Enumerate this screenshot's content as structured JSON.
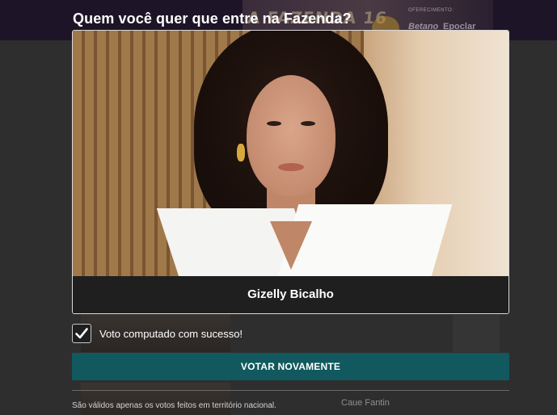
{
  "modal": {
    "title": "Quem você quer que entre na Fazenda?",
    "candidate": {
      "name": "Gizelly Bicalho",
      "photo_icon": "candidate-photo"
    },
    "success": {
      "icon": "check-icon",
      "text": "Voto computado com sucesso!"
    },
    "vote_again_label": "VOTAR NOVAMENTE",
    "validity_note": "São válidos apenas os votos feitos em território nacional."
  },
  "background": {
    "banner_title": "A FAZENDA 16",
    "sponsor_label": "OFERECIMENTO:",
    "sponsors": [
      "Betano",
      "Epoclar"
    ],
    "candidate_name_right": "Caue Fantin"
  },
  "colors": {
    "primary_button": "#11595e",
    "overlay": "#2b2b2b",
    "header": "#1e1427"
  }
}
